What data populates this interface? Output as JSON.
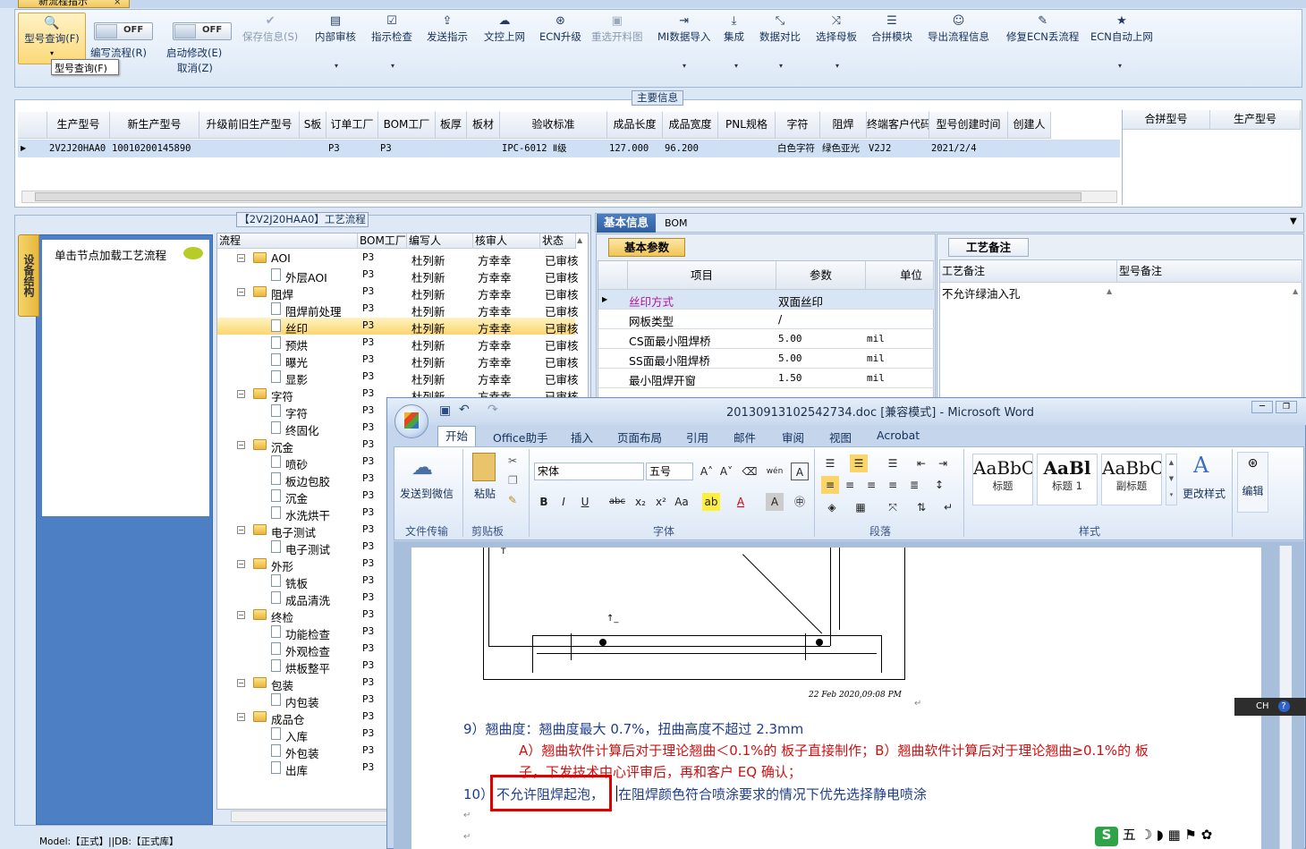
{
  "doc_tab": {
    "label": "新流程指示",
    "close": "×"
  },
  "toolbar": {
    "query": "型号查询(F)",
    "write_flow": "编写流程(R)",
    "start_edit": "启动修改(E)",
    "cancel": "取消(Z)",
    "toggle_off": "OFF",
    "tooltip": "型号查询(F)",
    "items": [
      {
        "label": "保存信息(S)",
        "icon": "check-icon",
        "disabled": true
      },
      {
        "label": "内部审核",
        "icon": "printer-icon"
      },
      {
        "label": "指示检查",
        "icon": "checkbox-icon"
      },
      {
        "label": "发送指示",
        "icon": "upload-icon"
      },
      {
        "label": "文控上网",
        "icon": "cloud-upload-icon"
      },
      {
        "label": "ECN升级",
        "icon": "binoculars-icon"
      },
      {
        "label": "重选开料图",
        "icon": "image-icon",
        "disabled": true
      },
      {
        "label": "MI数据导入",
        "icon": "import-icon"
      },
      {
        "label": "集成",
        "icon": "download-icon"
      },
      {
        "label": "数据对比",
        "icon": "compare-icon"
      },
      {
        "label": "选择母板",
        "icon": "shuffle-icon"
      },
      {
        "label": "合拼模块",
        "icon": "list-icon"
      },
      {
        "label": "导出流程信息",
        "icon": "smiley-icon"
      },
      {
        "label": "修复ECN丢流程",
        "icon": "wrench-icon"
      },
      {
        "label": "ECN自动上网",
        "icon": "star-icon"
      }
    ]
  },
  "main_info": {
    "title": "主要信息",
    "columns": [
      "生产型号",
      "新生产型号",
      "升级前旧生产型号",
      "S板",
      "订单工厂",
      "BOM工厂",
      "板厚",
      "板材",
      "验收标准",
      "成品长度",
      "成品宽度",
      "PNL规格",
      "字符",
      "阻焊",
      "终端客户代码",
      "型号创建时间",
      "创建人"
    ],
    "row": [
      "2V2J20HAA0",
      "10010200145890",
      "",
      "",
      "P3",
      "P3",
      "",
      "",
      "IPC-6012 Ⅱ级",
      "127.000",
      "96.200",
      "",
      "白色字符",
      "绿色亚光",
      "V2J2",
      "2021/2/4",
      ""
    ],
    "merge_columns": [
      "合拼型号",
      "生产型号"
    ]
  },
  "process": {
    "title": "【2V2J20HAA0】工艺流程",
    "vtab": "设备结构",
    "load_label": "单击节点加载工艺流程",
    "columns": [
      "流程",
      "BOM工厂",
      "编写人",
      "核审人",
      "状态"
    ],
    "rows": [
      {
        "name": "AOI",
        "type": "folder",
        "level": 0,
        "bom": "P3",
        "writer": "杜列新",
        "checker": "方幸幸",
        "status": "已审核"
      },
      {
        "name": "外层AOI",
        "type": "doc",
        "level": 1,
        "bom": "P3",
        "writer": "杜列新",
        "checker": "方幸幸",
        "status": "已审核"
      },
      {
        "name": "阻焊",
        "type": "folder",
        "level": 0,
        "bom": "P3",
        "writer": "杜列新",
        "checker": "方幸幸",
        "status": "已审核"
      },
      {
        "name": "阻焊前处理",
        "type": "doc",
        "level": 1,
        "bom": "P3",
        "writer": "杜列新",
        "checker": "方幸幸",
        "status": "已审核"
      },
      {
        "name": "丝印",
        "type": "doc",
        "level": 1,
        "bom": "P3",
        "writer": "杜列新",
        "checker": "方幸幸",
        "status": "已审核",
        "selected": true
      },
      {
        "name": "预烘",
        "type": "doc",
        "level": 1,
        "bom": "P3",
        "writer": "杜列新",
        "checker": "方幸幸",
        "status": "已审核"
      },
      {
        "name": "曝光",
        "type": "doc",
        "level": 1,
        "bom": "P3",
        "writer": "杜列新",
        "checker": "方幸幸",
        "status": "已审核"
      },
      {
        "name": "显影",
        "type": "doc",
        "level": 1,
        "bom": "P3",
        "writer": "杜列新",
        "checker": "方幸幸",
        "status": "已审核"
      },
      {
        "name": "字符",
        "type": "folder",
        "level": 0,
        "bom": "P3",
        "writer": "杜列新",
        "checker": "方幸幸",
        "status": "已审核"
      },
      {
        "name": "字符",
        "type": "doc",
        "level": 1,
        "bom": "P3",
        "writer": "",
        "checker": "",
        "status": ""
      },
      {
        "name": "终固化",
        "type": "doc",
        "level": 1,
        "bom": "P3",
        "writer": "",
        "checker": "",
        "status": ""
      },
      {
        "name": "沉金",
        "type": "folder",
        "level": 0,
        "bom": "P3",
        "writer": "",
        "checker": "",
        "status": ""
      },
      {
        "name": "喷砂",
        "type": "doc",
        "level": 1,
        "bom": "P3",
        "writer": "",
        "checker": "",
        "status": ""
      },
      {
        "name": "板边包胶",
        "type": "doc",
        "level": 1,
        "bom": "P3",
        "writer": "",
        "checker": "",
        "status": ""
      },
      {
        "name": "沉金",
        "type": "doc",
        "level": 1,
        "bom": "P3",
        "writer": "",
        "checker": "",
        "status": ""
      },
      {
        "name": "水洗烘干",
        "type": "doc",
        "level": 1,
        "bom": "P3",
        "writer": "",
        "checker": "",
        "status": ""
      },
      {
        "name": "电子测试",
        "type": "folder",
        "level": 0,
        "bom": "P3",
        "writer": "",
        "checker": "",
        "status": ""
      },
      {
        "name": "电子测试",
        "type": "doc",
        "level": 1,
        "bom": "P3",
        "writer": "",
        "checker": "",
        "status": ""
      },
      {
        "name": "外形",
        "type": "folder",
        "level": 0,
        "bom": "P3",
        "writer": "",
        "checker": "",
        "status": ""
      },
      {
        "name": "铣板",
        "type": "doc",
        "level": 1,
        "bom": "P3",
        "writer": "",
        "checker": "",
        "status": ""
      },
      {
        "name": "成品清洗",
        "type": "doc",
        "level": 1,
        "bom": "P3",
        "writer": "",
        "checker": "",
        "status": ""
      },
      {
        "name": "终检",
        "type": "folder",
        "level": 0,
        "bom": "P3",
        "writer": "",
        "checker": "",
        "status": ""
      },
      {
        "name": "功能检查",
        "type": "doc",
        "level": 1,
        "bom": "P3",
        "writer": "",
        "checker": "",
        "status": ""
      },
      {
        "name": "外观检查",
        "type": "doc",
        "level": 1,
        "bom": "P3",
        "writer": "",
        "checker": "",
        "status": ""
      },
      {
        "name": "烘板整平",
        "type": "doc",
        "level": 1,
        "bom": "P3",
        "writer": "",
        "checker": "",
        "status": ""
      },
      {
        "name": "包装",
        "type": "folder",
        "level": 0,
        "bom": "P3",
        "writer": "",
        "checker": "",
        "status": ""
      },
      {
        "name": "内包装",
        "type": "doc",
        "level": 1,
        "bom": "P3",
        "writer": "",
        "checker": "",
        "status": ""
      },
      {
        "name": "成品仓",
        "type": "folder",
        "level": 0,
        "bom": "P3",
        "writer": "",
        "checker": "",
        "status": ""
      },
      {
        "name": "入库",
        "type": "doc",
        "level": 1,
        "bom": "P3",
        "writer": "",
        "checker": "",
        "status": ""
      },
      {
        "name": "外包装",
        "type": "doc",
        "level": 1,
        "bom": "P3",
        "writer": "",
        "checker": "",
        "status": ""
      },
      {
        "name": "出库",
        "type": "doc",
        "level": 1,
        "bom": "P3",
        "writer": "",
        "checker": "",
        "status": ""
      }
    ]
  },
  "basic_info": {
    "tabs": [
      "基本信息",
      "BOM"
    ],
    "section": "基本参数",
    "columns": [
      "项目",
      "参数",
      "单位"
    ],
    "rows": [
      {
        "item": "丝印方式",
        "param": "双面丝印",
        "unit": ""
      },
      {
        "item": "网板类型",
        "param": "/",
        "unit": ""
      },
      {
        "item": "CS面最小阻焊桥",
        "param": "5.00",
        "unit": "mil"
      },
      {
        "item": "SS面最小阻焊桥",
        "param": "5.00",
        "unit": "mil"
      },
      {
        "item": "最小阻焊开窗",
        "param": "1.50",
        "unit": "mil"
      }
    ],
    "process_note_tab": "工艺备注",
    "note_columns": [
      "工艺备注",
      "型号备注"
    ],
    "note_text": "不允许绿油入孔"
  },
  "word": {
    "title": "20130913102542734.doc [兼容模式] - Microsoft Word",
    "tabs": [
      "开始",
      "Office助手",
      "插入",
      "页面布局",
      "引用",
      "邮件",
      "审阅",
      "视图",
      "Acrobat"
    ],
    "send_wechat": "发送到微信",
    "paste": "粘贴",
    "font_name": "宋体",
    "font_size": "五号",
    "styles": [
      {
        "preview": "AaBbC",
        "name": "标题"
      },
      {
        "preview": "AaBl",
        "name": "标题 1"
      },
      {
        "preview": "AaBbC",
        "name": "副标题"
      }
    ],
    "change_styles": "更改样式",
    "edit": "编辑",
    "groups": [
      "文件传输",
      "剪贴板",
      "字体",
      "段落",
      "样式"
    ],
    "drawing_date": "22 Feb 2020,09:08 PM",
    "line9": "9）翘曲度：翘曲度最大 0.7%，扭曲高度不超过 2.3mm",
    "line9a": "A）翘曲软件计算后对于理论翘曲＜0.1%的 板子直接制作；B）翘曲软件计算后对于理论翘曲≥0.1%的 板",
    "line9b": "子，下发技术中心评审后，再和客户 EQ 确认；",
    "line10_num": "10）",
    "line10_boxed": "不允许阻焊起泡，",
    "line10_rest": "在阻焊颜色符合喷涂要求的情况下优先选择静电喷涂",
    "ime": "CH",
    "ime_bar": "五"
  },
  "status_bar": "Model:【正式】||DB:【正式库】"
}
